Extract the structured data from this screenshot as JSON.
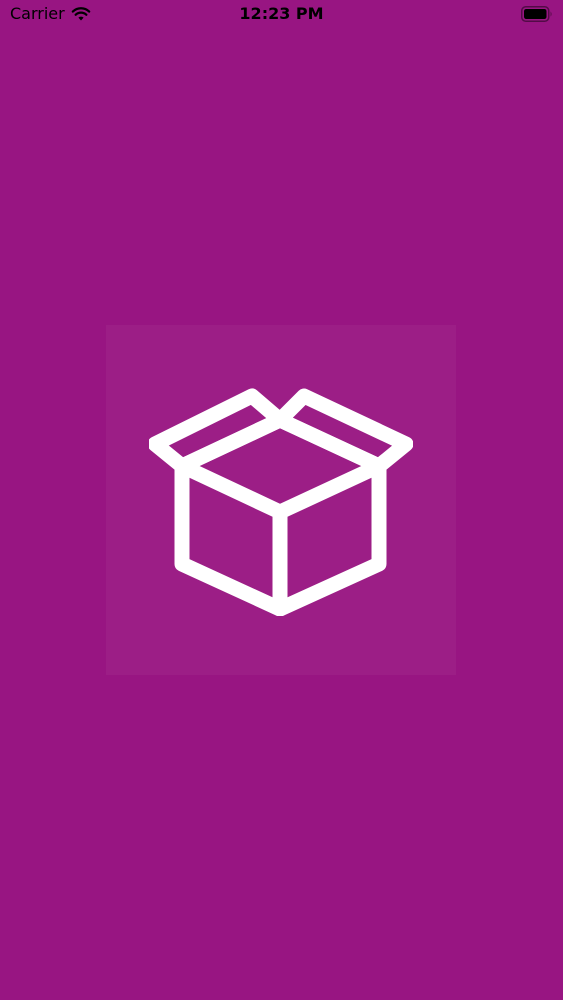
{
  "status_bar": {
    "carrier": "Carrier",
    "time": "12:23 PM",
    "wifi_icon": "wifi-icon",
    "battery_icon": "battery-full-icon"
  },
  "splash": {
    "icon": "open-box-icon"
  },
  "colors": {
    "background": "#981582",
    "icon": "#ffffff",
    "status_text": "#000000"
  }
}
